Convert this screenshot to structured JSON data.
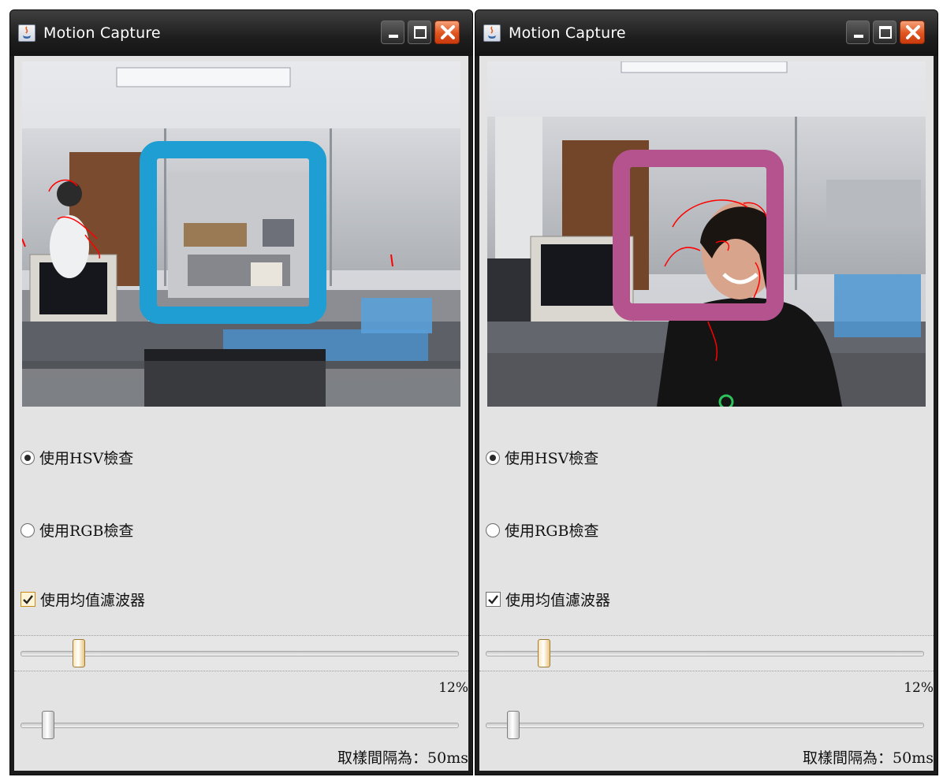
{
  "windows": [
    {
      "title": "Motion Capture",
      "options": {
        "hsv_label": "使用HSV檢查",
        "hsv_checked": true,
        "rgb_label": "使用RGB檢查",
        "rgb_checked": false,
        "filter_label": "使用均值濾波器",
        "filter_checked": true
      },
      "threshold": {
        "value_fraction": 0.12,
        "label": "12%"
      },
      "interval": {
        "value_fraction": 0.05,
        "label": "取樣間隔為：50ms"
      },
      "frame_color": "#1e9ed2"
    },
    {
      "title": "Motion Capture",
      "options": {
        "hsv_label": "使用HSV檢查",
        "hsv_checked": true,
        "rgb_label": "使用RGB檢查",
        "rgb_checked": false,
        "filter_label": "使用均值濾波器",
        "filter_checked": true
      },
      "threshold": {
        "value_fraction": 0.12,
        "label": "12%"
      },
      "interval": {
        "value_fraction": 0.05,
        "label": "取樣間隔為：50ms"
      },
      "frame_color": "#b5538f"
    }
  ],
  "icons": {
    "app": "java-icon",
    "minimize": "minimize-icon",
    "maximize": "maximize-icon",
    "close": "close-icon"
  },
  "colors": {
    "titlebar": "#1e1e1e",
    "client_bg": "#e3e3e3",
    "close_button": "#e0541f",
    "motion_outline": "#ff0000"
  }
}
